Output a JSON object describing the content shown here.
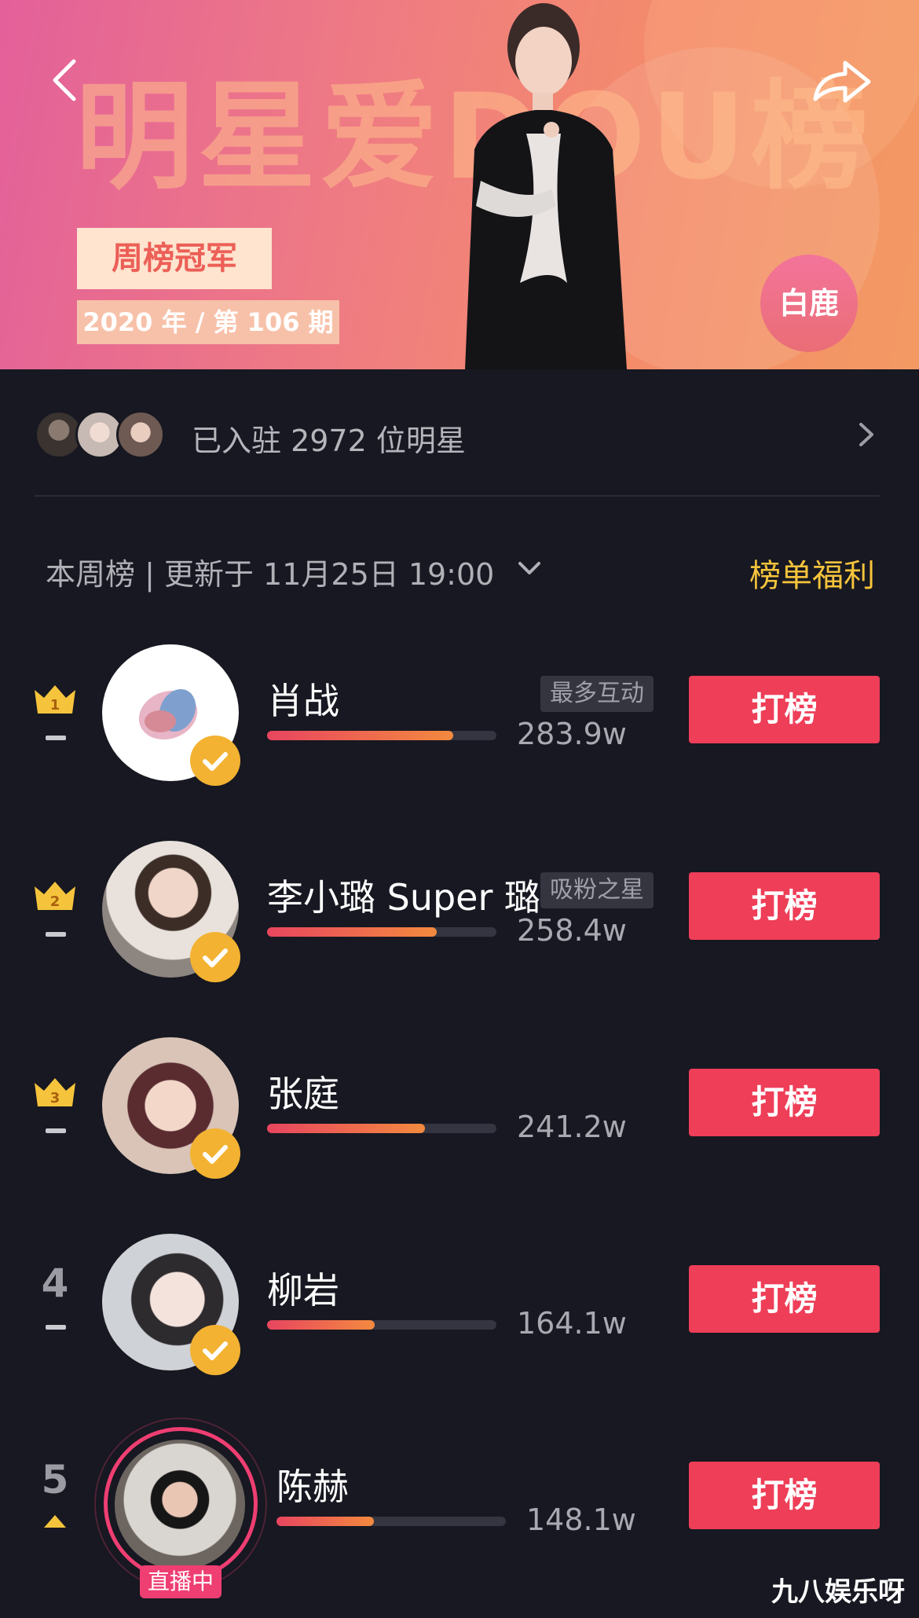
{
  "banner": {
    "title": "明星爱DOU榜",
    "champion_badge": "周榜冠军",
    "issue": "2020 年 / 第 106 期",
    "star_name": "白鹿"
  },
  "joined": {
    "text": "已入驻 2972 位明星"
  },
  "week": {
    "label": "本周榜 | 更新于 11月25日 19:00",
    "benefits": "榜单福利"
  },
  "colors": {
    "accent_red": "#ee3e58",
    "gold": "#f6c43c",
    "verified": "#f3b232",
    "live": "#ee3e72"
  },
  "ranking": [
    {
      "rank": "1",
      "name": "肖战",
      "tag": "最多互动",
      "score": "283.9w",
      "value": 283.9,
      "vote": "打榜",
      "trend": "same",
      "verified": true,
      "live": false
    },
    {
      "rank": "2",
      "name": "李小璐 Super 璐",
      "tag": "吸粉之星",
      "score": "258.4w",
      "value": 258.4,
      "vote": "打榜",
      "trend": "same",
      "verified": true,
      "live": false
    },
    {
      "rank": "3",
      "name": "张庭",
      "tag": "",
      "score": "241.2w",
      "value": 241.2,
      "vote": "打榜",
      "trend": "same",
      "verified": true,
      "live": false
    },
    {
      "rank": "4",
      "name": "柳岩",
      "tag": "",
      "score": "164.1w",
      "value": 164.1,
      "vote": "打榜",
      "trend": "same",
      "verified": true,
      "live": false
    },
    {
      "rank": "5",
      "name": "陈赫",
      "tag": "",
      "score": "148.1w",
      "value": 148.1,
      "vote": "打榜",
      "trend": "up",
      "verified": false,
      "live": true,
      "live_label": "直播中"
    }
  ],
  "bar_max_value": 350,
  "watermark": "九八娱乐呀"
}
